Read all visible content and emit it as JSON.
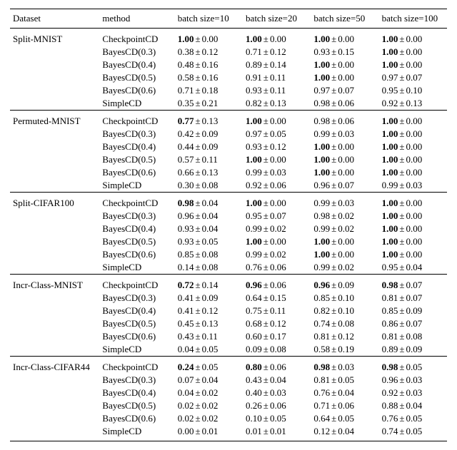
{
  "chart_data": {
    "type": "table",
    "title": "",
    "columns": [
      "Dataset",
      "method",
      "batch size=10",
      "batch size=20",
      "batch size=50",
      "batch size=100"
    ],
    "groups": [
      {
        "dataset": "Split-MNIST",
        "rows": [
          {
            "method": "CheckpointCD",
            "v": [
              {
                "m": "1.00",
                "s": "0.00",
                "b": true
              },
              {
                "m": "1.00",
                "s": "0.00",
                "b": true
              },
              {
                "m": "1.00",
                "s": "0.00",
                "b": true
              },
              {
                "m": "1.00",
                "s": "0.00",
                "b": true
              }
            ]
          },
          {
            "method": "BayesCD(0.3)",
            "v": [
              {
                "m": "0.38",
                "s": "0.12",
                "b": false
              },
              {
                "m": "0.71",
                "s": "0.12",
                "b": false
              },
              {
                "m": "0.93",
                "s": "0.15",
                "b": false
              },
              {
                "m": "1.00",
                "s": "0.00",
                "b": true
              }
            ]
          },
          {
            "method": "BayesCD(0.4)",
            "v": [
              {
                "m": "0.48",
                "s": "0.16",
                "b": false
              },
              {
                "m": "0.89",
                "s": "0.14",
                "b": false
              },
              {
                "m": "1.00",
                "s": "0.00",
                "b": true
              },
              {
                "m": "1.00",
                "s": "0.00",
                "b": true
              }
            ]
          },
          {
            "method": "BayesCD(0.5)",
            "v": [
              {
                "m": "0.58",
                "s": "0.16",
                "b": false
              },
              {
                "m": "0.91",
                "s": "0.11",
                "b": false
              },
              {
                "m": "1.00",
                "s": "0.00",
                "b": true
              },
              {
                "m": "0.97",
                "s": "0.07",
                "b": false
              }
            ]
          },
          {
            "method": "BayesCD(0.6)",
            "v": [
              {
                "m": "0.71",
                "s": "0.18",
                "b": false
              },
              {
                "m": "0.93",
                "s": "0.11",
                "b": false
              },
              {
                "m": "0.97",
                "s": "0.07",
                "b": false
              },
              {
                "m": "0.95",
                "s": "0.10",
                "b": false
              }
            ]
          },
          {
            "method": "SimpleCD",
            "v": [
              {
                "m": "0.35",
                "s": "0.21",
                "b": false
              },
              {
                "m": "0.82",
                "s": "0.13",
                "b": false
              },
              {
                "m": "0.98",
                "s": "0.06",
                "b": false
              },
              {
                "m": "0.92",
                "s": "0.13",
                "b": false
              }
            ]
          }
        ]
      },
      {
        "dataset": "Permuted-MNIST",
        "rows": [
          {
            "method": "CheckpointCD",
            "v": [
              {
                "m": "0.77",
                "s": "0.13",
                "b": true
              },
              {
                "m": "1.00",
                "s": "0.00",
                "b": true
              },
              {
                "m": "0.98",
                "s": "0.06",
                "b": false
              },
              {
                "m": "1.00",
                "s": "0.00",
                "b": true
              }
            ]
          },
          {
            "method": "BayesCD(0.3)",
            "v": [
              {
                "m": "0.42",
                "s": "0.09",
                "b": false
              },
              {
                "m": "0.97",
                "s": "0.05",
                "b": false
              },
              {
                "m": "0.99",
                "s": "0.03",
                "b": false
              },
              {
                "m": "1.00",
                "s": "0.00",
                "b": true
              }
            ]
          },
          {
            "method": "BayesCD(0.4)",
            "v": [
              {
                "m": "0.44",
                "s": "0.09",
                "b": false
              },
              {
                "m": "0.93",
                "s": "0.12",
                "b": false
              },
              {
                "m": "1.00",
                "s": "0.00",
                "b": true
              },
              {
                "m": "1.00",
                "s": "0.00",
                "b": true
              }
            ]
          },
          {
            "method": "BayesCD(0.5)",
            "v": [
              {
                "m": "0.57",
                "s": "0.11",
                "b": false
              },
              {
                "m": "1.00",
                "s": "0.00",
                "b": true
              },
              {
                "m": "1.00",
                "s": "0.00",
                "b": true
              },
              {
                "m": "1.00",
                "s": "0.00",
                "b": true
              }
            ]
          },
          {
            "method": "BayesCD(0.6)",
            "v": [
              {
                "m": "0.66",
                "s": "0.13",
                "b": false
              },
              {
                "m": "0.99",
                "s": "0.03",
                "b": false
              },
              {
                "m": "1.00",
                "s": "0.00",
                "b": true
              },
              {
                "m": "1.00",
                "s": "0.00",
                "b": true
              }
            ]
          },
          {
            "method": "SimpleCD",
            "v": [
              {
                "m": "0.30",
                "s": "0.08",
                "b": false
              },
              {
                "m": "0.92",
                "s": "0.06",
                "b": false
              },
              {
                "m": "0.96",
                "s": "0.07",
                "b": false
              },
              {
                "m": "0.99",
                "s": "0.03",
                "b": false
              }
            ]
          }
        ]
      },
      {
        "dataset": "Split-CIFAR100",
        "rows": [
          {
            "method": "CheckpointCD",
            "v": [
              {
                "m": "0.98",
                "s": "0.04",
                "b": true
              },
              {
                "m": "1.00",
                "s": "0.00",
                "b": true
              },
              {
                "m": "0.99",
                "s": "0.03",
                "b": false
              },
              {
                "m": "1.00",
                "s": "0.00",
                "b": true
              }
            ]
          },
          {
            "method": "BayesCD(0.3)",
            "v": [
              {
                "m": "0.96",
                "s": "0.04",
                "b": false
              },
              {
                "m": "0.95",
                "s": "0.07",
                "b": false
              },
              {
                "m": "0.98",
                "s": "0.02",
                "b": false
              },
              {
                "m": "1.00",
                "s": "0.00",
                "b": true
              }
            ]
          },
          {
            "method": "BayesCD(0.4)",
            "v": [
              {
                "m": "0.93",
                "s": "0.04",
                "b": false
              },
              {
                "m": "0.99",
                "s": "0.02",
                "b": false
              },
              {
                "m": "0.99",
                "s": "0.02",
                "b": false
              },
              {
                "m": "1.00",
                "s": "0.00",
                "b": true
              }
            ]
          },
          {
            "method": "BayesCD(0.5)",
            "v": [
              {
                "m": "0.93",
                "s": "0.05",
                "b": false
              },
              {
                "m": "1.00",
                "s": "0.00",
                "b": true
              },
              {
                "m": "1.00",
                "s": "0.00",
                "b": true
              },
              {
                "m": "1.00",
                "s": "0.00",
                "b": true
              }
            ]
          },
          {
            "method": "BayesCD(0.6)",
            "v": [
              {
                "m": "0.85",
                "s": "0.08",
                "b": false
              },
              {
                "m": "0.99",
                "s": "0.02",
                "b": false
              },
              {
                "m": "1.00",
                "s": "0.00",
                "b": true
              },
              {
                "m": "1.00",
                "s": "0.00",
                "b": true
              }
            ]
          },
          {
            "method": "SimpleCD",
            "v": [
              {
                "m": "0.14",
                "s": "0.08",
                "b": false
              },
              {
                "m": "0.76",
                "s": "0.06",
                "b": false
              },
              {
                "m": "0.99",
                "s": "0.02",
                "b": false
              },
              {
                "m": "0.95",
                "s": "0.04",
                "b": false
              }
            ]
          }
        ]
      },
      {
        "dataset": "Incr-Class-MNIST",
        "rows": [
          {
            "method": "CheckpointCD",
            "v": [
              {
                "m": "0.72",
                "s": "0.14",
                "b": true
              },
              {
                "m": "0.96",
                "s": "0.06",
                "b": true
              },
              {
                "m": "0.96",
                "s": "0.09",
                "b": true
              },
              {
                "m": "0.98",
                "s": "0.07",
                "b": true
              }
            ]
          },
          {
            "method": "BayesCD(0.3)",
            "v": [
              {
                "m": "0.41",
                "s": "0.09",
                "b": false
              },
              {
                "m": "0.64",
                "s": "0.15",
                "b": false
              },
              {
                "m": "0.85",
                "s": "0.10",
                "b": false
              },
              {
                "m": "0.81",
                "s": "0.07",
                "b": false
              }
            ]
          },
          {
            "method": "BayesCD(0.4)",
            "v": [
              {
                "m": "0.41",
                "s": "0.12",
                "b": false
              },
              {
                "m": "0.75",
                "s": "0.11",
                "b": false
              },
              {
                "m": "0.82",
                "s": "0.10",
                "b": false
              },
              {
                "m": "0.85",
                "s": "0.09",
                "b": false
              }
            ]
          },
          {
            "method": "BayesCD(0.5)",
            "v": [
              {
                "m": "0.45",
                "s": "0.13",
                "b": false
              },
              {
                "m": "0.68",
                "s": "0.12",
                "b": false
              },
              {
                "m": "0.74",
                "s": "0.08",
                "b": false
              },
              {
                "m": "0.86",
                "s": "0.07",
                "b": false
              }
            ]
          },
          {
            "method": "BayesCD(0.6)",
            "v": [
              {
                "m": "0.43",
                "s": "0.11",
                "b": false
              },
              {
                "m": "0.60",
                "s": "0.17",
                "b": false
              },
              {
                "m": "0.81",
                "s": "0.12",
                "b": false
              },
              {
                "m": "0.81",
                "s": "0.08",
                "b": false
              }
            ]
          },
          {
            "method": "SimpleCD",
            "v": [
              {
                "m": "0.04",
                "s": "0.05",
                "b": false
              },
              {
                "m": "0.09",
                "s": "0.08",
                "b": false
              },
              {
                "m": "0.58",
                "s": "0.19",
                "b": false
              },
              {
                "m": "0.89",
                "s": "0.09",
                "b": false
              }
            ]
          }
        ]
      },
      {
        "dataset": "Incr-Class-CIFAR44",
        "rows": [
          {
            "method": "CheckpointCD",
            "v": [
              {
                "m": "0.24",
                "s": "0.05",
                "b": true
              },
              {
                "m": "0.80",
                "s": "0.06",
                "b": true
              },
              {
                "m": "0.98",
                "s": "0.03",
                "b": true
              },
              {
                "m": "0.98",
                "s": "0.05",
                "b": true
              }
            ]
          },
          {
            "method": "BayesCD(0.3)",
            "v": [
              {
                "m": "0.07",
                "s": "0.04",
                "b": false
              },
              {
                "m": "0.43",
                "s": "0.04",
                "b": false
              },
              {
                "m": "0.81",
                "s": "0.05",
                "b": false
              },
              {
                "m": "0.96",
                "s": "0.03",
                "b": false
              }
            ]
          },
          {
            "method": "BayesCD(0.4)",
            "v": [
              {
                "m": "0.04",
                "s": "0.02",
                "b": false
              },
              {
                "m": "0.40",
                "s": "0.03",
                "b": false
              },
              {
                "m": "0.76",
                "s": "0.04",
                "b": false
              },
              {
                "m": "0.92",
                "s": "0.03",
                "b": false
              }
            ]
          },
          {
            "method": "BayesCD(0.5)",
            "v": [
              {
                "m": "0.02",
                "s": "0.02",
                "b": false
              },
              {
                "m": "0.26",
                "s": "0.06",
                "b": false
              },
              {
                "m": "0.71",
                "s": "0.06",
                "b": false
              },
              {
                "m": "0.88",
                "s": "0.04",
                "b": false
              }
            ]
          },
          {
            "method": "BayesCD(0.6)",
            "v": [
              {
                "m": "0.02",
                "s": "0.02",
                "b": false
              },
              {
                "m": "0.10",
                "s": "0.05",
                "b": false
              },
              {
                "m": "0.64",
                "s": "0.05",
                "b": false
              },
              {
                "m": "0.76",
                "s": "0.05",
                "b": false
              }
            ]
          },
          {
            "method": "SimpleCD",
            "v": [
              {
                "m": "0.00",
                "s": "0.01",
                "b": false
              },
              {
                "m": "0.01",
                "s": "0.01",
                "b": false
              },
              {
                "m": "0.12",
                "s": "0.04",
                "b": false
              },
              {
                "m": "0.74",
                "s": "0.05",
                "b": false
              }
            ]
          }
        ]
      }
    ]
  }
}
